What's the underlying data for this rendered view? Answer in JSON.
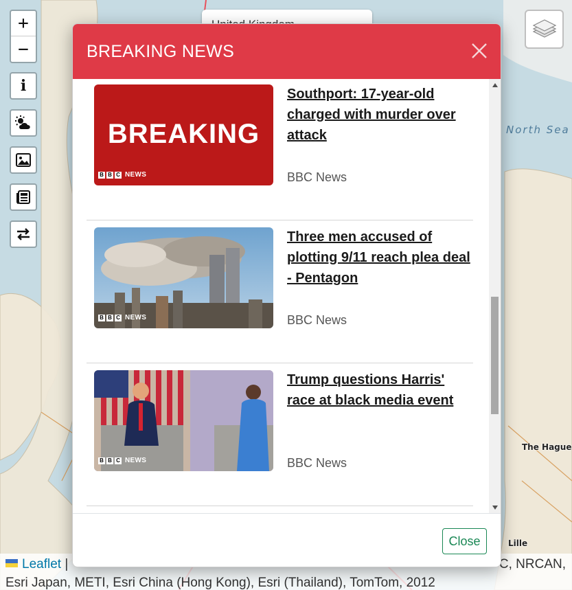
{
  "map": {
    "sea_label": "North Sea",
    "city_label": "The Hague",
    "city_label_lille": "Lille",
    "search_value": "United Kingdom"
  },
  "controls": {
    "zoom_in": "+",
    "zoom_out": "−",
    "info_icon": "info-icon",
    "weather_icon": "weather-icon",
    "image_icon": "image-icon",
    "news_icon": "newspaper-icon",
    "swap_icon": "swap-arrows-icon",
    "layers_icon": "layers-icon"
  },
  "modal": {
    "title": "BREAKING NEWS",
    "close_label": "Close",
    "header_color": "#df3a47",
    "items": [
      {
        "headline": "Southport: 17-year-old charged with murder over attack",
        "source": "BBC News",
        "image_text": "BREAKING",
        "badge": "NEWS"
      },
      {
        "headline": "Three men accused of plotting 9/11 reach plea deal - Pentagon",
        "source": "BBC News",
        "badge": "NEWS"
      },
      {
        "headline": "Trump questions Harris' race at black media event",
        "source": "BBC News",
        "badge": "NEWS"
      }
    ]
  },
  "attribution": {
    "leaflet": "Leaflet",
    "separator": "|",
    "line1_tail": "C, NRCAN,",
    "line2": "Esri Japan, METI, Esri China (Hong Kong), Esri (Thailand), TomTom, 2012"
  }
}
